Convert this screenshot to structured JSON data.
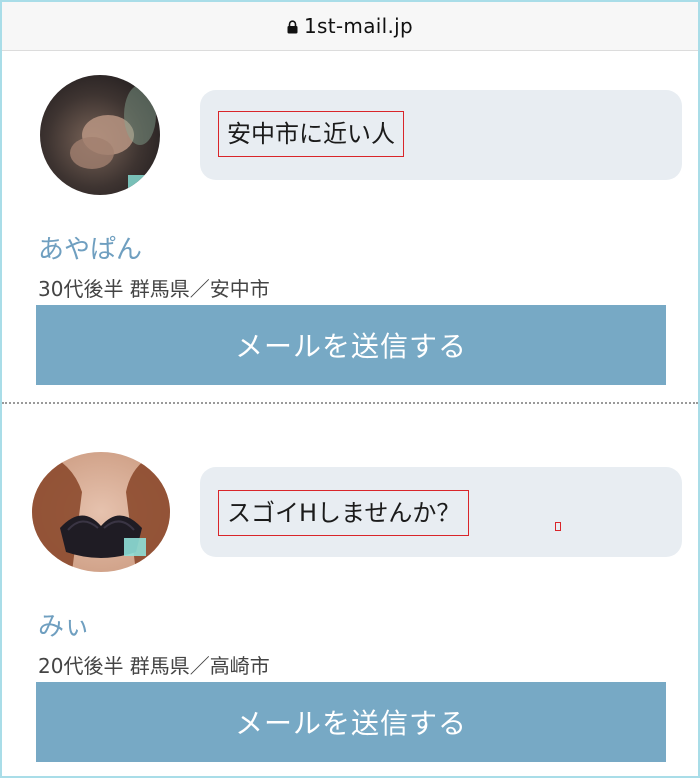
{
  "browser": {
    "url": "1st-mail.jp",
    "lock_icon": "lock-icon"
  },
  "profiles": [
    {
      "message": "安中市に近い人",
      "name": "あやぱん",
      "meta": "30代後半 群馬県／安中市",
      "send_label": "メールを送信する"
    },
    {
      "message": "スゴイHしませんか？",
      "name": "みぃ",
      "meta": "20代後半 群馬県／高崎市",
      "send_label": "メールを送信する"
    }
  ],
  "colors": {
    "frame_border": "#a9dde8",
    "bubble_bg": "#e8edf2",
    "highlight_border": "#d9252a",
    "name_text": "#6f9fc0",
    "button_bg": "#77a9c5",
    "button_text": "#ffffff"
  }
}
